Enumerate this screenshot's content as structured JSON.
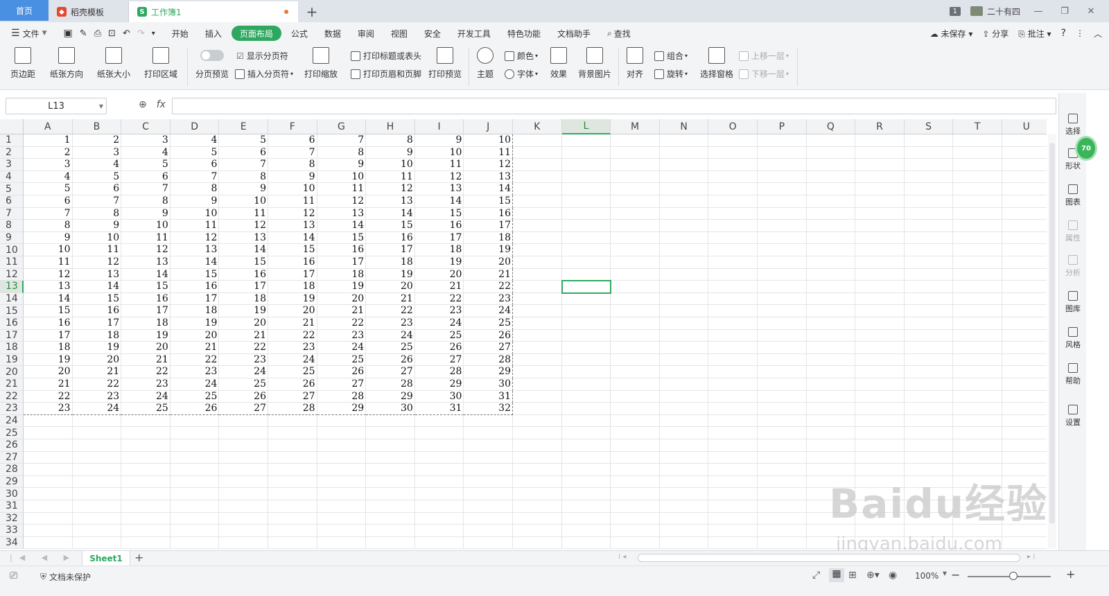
{
  "tabs": {
    "home": "首页",
    "template": "稻壳模板",
    "workbook": "工作簿1"
  },
  "titlebar": {
    "badge": "1",
    "user": "二十有四"
  },
  "menu": {
    "file": "文件",
    "items": [
      "开始",
      "插入",
      "页面布局",
      "公式",
      "数据",
      "审阅",
      "视图",
      "安全",
      "开发工具",
      "特色功能",
      "文档助手"
    ],
    "active_index": 2,
    "search": "查找",
    "unsaved": "未保存",
    "share": "分享",
    "comment": "批注"
  },
  "ribbon": {
    "margin": "页边距",
    "orientation": "纸张方向",
    "size": "纸张大小",
    "print_area": "打印区域",
    "page_break_preview": "分页预览",
    "show_page_break": "显示分页符",
    "insert_page_break": "插入分页符",
    "print_scale": "打印缩放",
    "print_titles": "打印标题或表头",
    "print_header_footer": "打印页眉和页脚",
    "print_preview": "打印预览",
    "theme": "主题",
    "color": "颜色",
    "font": "字体",
    "effect": "效果",
    "bg_image": "背景图片",
    "align": "对齐",
    "group": "组合",
    "rotate": "旋转",
    "selection_pane": "选择窗格",
    "bring_forward": "上移一层",
    "send_backward": "下移一层"
  },
  "formula": {
    "namebox": "L13",
    "fx": "fx",
    "value": ""
  },
  "grid": {
    "columns": [
      "A",
      "B",
      "C",
      "D",
      "E",
      "F",
      "G",
      "H",
      "I",
      "J",
      "K",
      "L",
      "M",
      "N",
      "O",
      "P",
      "Q",
      "R",
      "S",
      "T",
      "U"
    ],
    "selected_col": "L",
    "selected_row": 13,
    "row_count": 34,
    "data_rows": 23,
    "data_cols": 10
  },
  "rightbar": [
    "选择",
    "形状",
    "图表",
    "属性",
    "分析",
    "图库",
    "风格",
    "帮助",
    "设置"
  ],
  "sheetbar": {
    "sheet": "Sheet1"
  },
  "status": {
    "protect": "文档未保护",
    "zoom": "100%"
  },
  "watermark": {
    "line1": "Baidu经验",
    "line2": "jingyan.baidu.com"
  },
  "colors": {
    "accent": "#2ea861",
    "home_tab": "#4a90e2"
  }
}
